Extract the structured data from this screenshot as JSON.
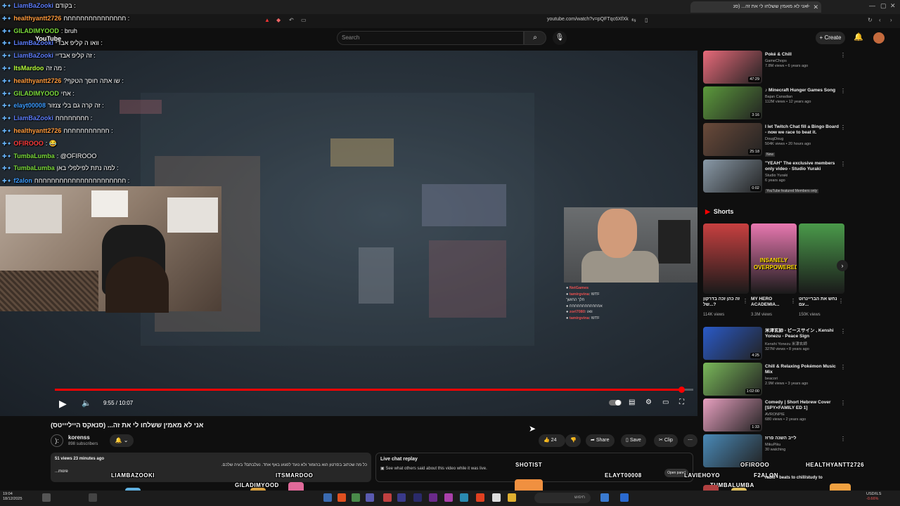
{
  "browser": {
    "tab_title": "אני לא מאמין ששלחו לי את זה... (סנ",
    "url": "youtube.com/watch?v=pQFTqc6XfXk"
  },
  "youtube": {
    "logo": "YouTube",
    "search_placeholder": "Search",
    "create_label": "Create"
  },
  "chat": [
    {
      "user": "LiamBaZooki",
      "msg": "בקודם",
      "color": "#5c7cfa"
    },
    {
      "user": "healthyantt2726",
      "msg": "חחחחחחחחחחחחחחח",
      "color": "#ff9a3c"
    },
    {
      "user": "GILADIMYOOD",
      "msg": "bruh",
      "color": "#7cdc3c"
    },
    {
      "user": "LiamBaZooki",
      "msg": "וואו ה קליפ אבדי",
      "color": "#5c7cfa"
    },
    {
      "user": "LiamBaZooki",
      "msg": "זה קליפ אבדיי",
      "color": "#5c7cfa"
    },
    {
      "user": "ItsMardoo",
      "msg": "מה זה",
      "color": "#b8ff3c"
    },
    {
      "user": "healthyantt2726",
      "msg": "שו אתה חוסך הטקף?",
      "color": "#ff9a3c"
    },
    {
      "user": "GILADIMYOOD",
      "msg": "אחי",
      "color": "#7cdc3c"
    },
    {
      "user": "elayt00008",
      "msg": "זה קרה גם בלי צנזור",
      "color": "#3c9cff"
    },
    {
      "user": "LiamBaZooki",
      "msg": "חחחחחחחח",
      "color": "#5c7cfa"
    },
    {
      "user": "healthyantt2726",
      "msg": "חחחחחחחחחחח",
      "color": "#ff9a3c"
    },
    {
      "user": "OFIROOO",
      "msg": "😂",
      "color": "#ff3c3c"
    },
    {
      "user": "TumbaLumba",
      "msg": "@OFIROOO",
      "color": "#7cdc3c"
    },
    {
      "user": "TumbaLumba",
      "msg": "למה נתת לפילפלי באן",
      "color": "#7cdc3c"
    },
    {
      "user": "f2alon",
      "msg": "חחחחחחחחחחחחחחחחחחחחחח",
      "color": "#3c9cff"
    }
  ],
  "overlay_chat": [
    {
      "name": "NetGames",
      "msg": ""
    },
    {
      "name": "tamirgvina",
      "msg": "WTF"
    },
    {
      "name": "",
      "msg": "חלך החושך"
    },
    {
      "name": "",
      "msg": "אחחחחחחחחחחחח"
    },
    {
      "name": "zorl7080",
      "msg": "וואו"
    },
    {
      "name": "tamirgvina",
      "msg": "WTF"
    }
  ],
  "player": {
    "time": "9:55 / 10:07",
    "progress": 0.981
  },
  "video": {
    "title": "אני לא מאמין ששלחו לי את זה... (סנאקס הייליייטס)",
    "channel": "korenss",
    "subscribers": "898 subscribers",
    "likes": "24",
    "share": "Share",
    "save": "Save",
    "clip": "Clip",
    "views": "51 views  23 minutes ago",
    "description": "כל מה שכתוב בסרטון הוא בהומור ולא נועד לפגוע באף אחד. נעלבתם? בעיה שלכם.",
    "description_more": "...more",
    "replay_title": "Live chat replay",
    "replay_sub": "See what others said about this video while it was live.",
    "open_panel": "Open panel"
  },
  "sidebar": [
    {
      "title": "Poké & Chill",
      "channel": "GameChops",
      "stats": "7.8M views • 6 years ago",
      "duration": "47:29",
      "color": "#e86a7a"
    },
    {
      "title": "♪ Minecraft Hunger Games Song",
      "channel": "Bajan Canadian",
      "stats": "112M views • 12 years ago",
      "duration": "3:16",
      "color": "#5c9a3c"
    },
    {
      "title": "I let Twitch Chat fill a Bingo Board - now we race to beat it.",
      "channel": "DougDoug",
      "stats": "504K views • 20 hours ago",
      "duration": "25:18",
      "badge": "New",
      "color": "#6a4a3a"
    },
    {
      "title": "\"YEAH\" The exclusive members only video - Studio Yuraki",
      "channel": "Studio Yuraki",
      "stats": "6 years ago",
      "duration": "0:02",
      "badge": "YouTube featured   Members only",
      "color": "#8a9aa8"
    }
  ],
  "shorts": {
    "heading": "Shorts",
    "items": [
      {
        "title": "זה כהן זכה בדרקון של...?",
        "views": "114K views",
        "color": "#c84040"
      },
      {
        "title": "MY HERO ACADEMIA...",
        "views": "3.3M views",
        "color": "#e878b0"
      },
      {
        "title": "נחש את הבריינרוט עם...",
        "views": "150K views",
        "color": "#4a9a4a"
      }
    ],
    "thumb_text": "INSANELY OVERPOWERED"
  },
  "sidebar2": [
    {
      "title": "米津玄師 - ピースサイン , Kenshi Yonezu - Peace Sign",
      "channel": "Kenshi Yonezu 米津玄師",
      "stats": "327M views • 8 years ago",
      "duration": "4:25",
      "color": "#2a5ac8"
    },
    {
      "title": "Chill & Relaxing Pokémon Music Mix",
      "channel": "beacori",
      "stats": "2.9M views • 3 years ago",
      "duration": "1:02:00",
      "color": "#7ab85a"
    },
    {
      "title": "Comedy | Short Hebrew Cover [SPY×FAMILY ED 1]",
      "channel": "AVRONPIE",
      "stats": "680 views • 2 years ago",
      "duration": "1:33",
      "color": "#e8a0c0"
    },
    {
      "title": "לייב השנה פרוז",
      "channel": "MikuPiku",
      "stats": "30 watching",
      "duration": "",
      "color": "#4a8ab8"
    }
  ],
  "overlay_names": [
    "SHOTIST",
    "ITSMARDOO",
    "LIAMBAZOOKI",
    "GILADIMYOOD",
    "ELAYT00008",
    "LAVIEHOYO",
    "F2ALON",
    "OFIROOO",
    "HEALTHYANTT2726",
    "TUMBALUMBA"
  ],
  "taskbar": {
    "time": "19:04",
    "date": "18/12/2025",
    "search": "חיפוש",
    "stock": "USD/ILS",
    "stock_change": "-0.66%"
  },
  "partial_text": "radio • beats to chill/study to"
}
